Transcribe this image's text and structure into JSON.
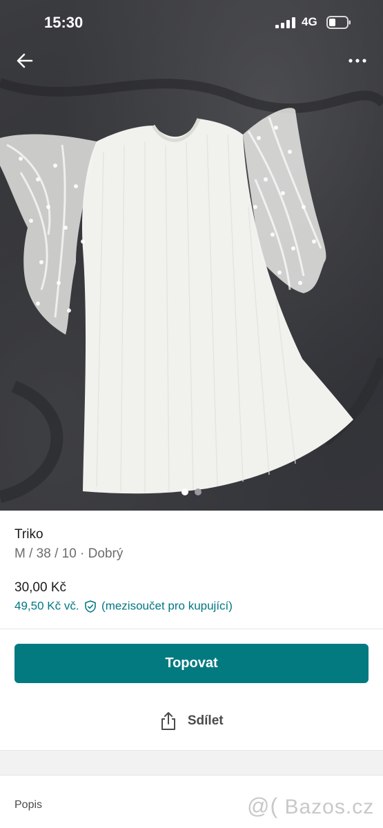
{
  "status_bar": {
    "time": "15:30",
    "network": "4G",
    "icons": [
      "signal-icon",
      "battery-icon"
    ]
  },
  "navigation": {
    "back_icon": "arrow-left-icon",
    "more_icon": "more-horizontal-icon"
  },
  "gallery": {
    "photo_count": 2,
    "active_index": 0
  },
  "item": {
    "title": "Triko",
    "details": "M / 38 / 10 · Dobrý",
    "price": "30,00 Kč",
    "buyer_price": "49,50 Kč vč.",
    "buyer_price_note": "(mezisoučet pro kupující)"
  },
  "actions": {
    "bump_label": "Topovat",
    "share_label": "Sdílet"
  },
  "description": {
    "label": "Popis"
  },
  "watermark": {
    "logo": "@(",
    "text": "Bazos.cz"
  },
  "colors": {
    "accent": "#027a80",
    "link": "#007782",
    "photo_background": "#333438"
  }
}
